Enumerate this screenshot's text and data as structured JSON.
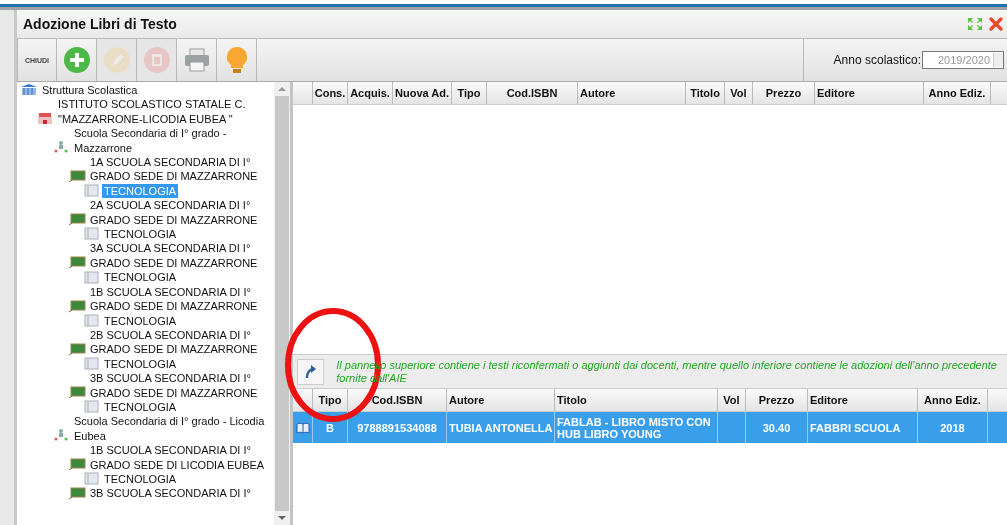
{
  "window": {
    "title": "Adozione Libri di Testo"
  },
  "toolbar": {
    "buttons": [
      {
        "kind": "close",
        "label": "CHIUDI",
        "disabled": false
      },
      {
        "kind": "add",
        "disabled": false
      },
      {
        "kind": "edit",
        "disabled": true
      },
      {
        "kind": "delete",
        "disabled": true
      },
      {
        "kind": "print",
        "disabled": false
      },
      {
        "kind": "hint",
        "disabled": false
      }
    ],
    "school_year": {
      "label": "Anno scolastico:",
      "value": "2019/2020"
    }
  },
  "tree": {
    "kind": "structure",
    "label": "Struttura Scolastica",
    "selected": false,
    "children": [
      {
        "kind": "institute",
        "label": "ISTITUTO SCOLASTICO STATALE C. \"MAZZARRONE-LICODIA EUBEA \"",
        "selected": false,
        "children": [
          {
            "kind": "school",
            "label": "Scuola Secondaria di I° grado - Mazzarrone",
            "selected": false,
            "children": [
              {
                "kind": "class",
                "label": "1A SCUOLA SECONDARIA DI I° GRADO SEDE DI MAZZARRONE",
                "selected": false,
                "children": [
                  {
                    "kind": "subject",
                    "label": "TECNOLOGIA",
                    "selected": true
                  }
                ]
              },
              {
                "kind": "class",
                "label": "2A SCUOLA SECONDARIA DI I° GRADO SEDE DI MAZZARRONE",
                "selected": false,
                "children": [
                  {
                    "kind": "subject",
                    "label": "TECNOLOGIA",
                    "selected": false
                  }
                ]
              },
              {
                "kind": "class",
                "label": "3A SCUOLA SECONDARIA DI I° GRADO SEDE DI MAZZARRONE",
                "selected": false,
                "children": [
                  {
                    "kind": "subject",
                    "label": "TECNOLOGIA",
                    "selected": false
                  }
                ]
              },
              {
                "kind": "class",
                "label": "1B SCUOLA SECONDARIA DI I° GRADO SEDE DI MAZZARRONE",
                "selected": false,
                "children": [
                  {
                    "kind": "subject",
                    "label": "TECNOLOGIA",
                    "selected": false
                  }
                ]
              },
              {
                "kind": "class",
                "label": "2B SCUOLA SECONDARIA DI I° GRADO SEDE DI MAZZARRONE",
                "selected": false,
                "children": [
                  {
                    "kind": "subject",
                    "label": "TECNOLOGIA",
                    "selected": false
                  }
                ]
              },
              {
                "kind": "class",
                "label": "3B SCUOLA SECONDARIA DI I° GRADO SEDE DI MAZZARRONE",
                "selected": false,
                "children": [
                  {
                    "kind": "subject",
                    "label": "TECNOLOGIA",
                    "selected": false
                  }
                ]
              }
            ]
          },
          {
            "kind": "school",
            "label": "Scuola Secondaria di I° grado - Licodia Eubea",
            "selected": false,
            "children": [
              {
                "kind": "class",
                "label": "1B SCUOLA SECONDARIA DI I° GRADO SEDE DI LICODIA EUBEA",
                "selected": false,
                "children": [
                  {
                    "kind": "subject",
                    "label": "TECNOLOGIA",
                    "selected": false
                  }
                ]
              },
              {
                "kind": "class",
                "label": "3B SCUOLA SECONDARIA DI I°",
                "selected": false
              }
            ]
          }
        ]
      }
    ]
  },
  "upper_table": {
    "columns": [
      "Cons.",
      "Acquis.",
      "Nuova Ad.",
      "Tipo",
      "Cod.ISBN",
      "Autore",
      "Titolo",
      "Vol",
      "Prezzo",
      "Editore",
      "Anno Ediz."
    ]
  },
  "info_bar": {
    "message": "Il pannello superiore contiene i testi riconfermati o aggiunti dai docenti, mentre quello inferiore contiene le adozioni dell'anno precedente fornite dall'AIE"
  },
  "lower_table": {
    "columns": [
      "Tipo",
      "Cod.ISBN",
      "Autore",
      "Titolo",
      "Vol",
      "Prezzo",
      "Editore",
      "Anno Ediz."
    ],
    "rows": [
      {
        "selected": true,
        "cells": [
          "B",
          "9788891534088",
          "TUBIA ANTONELLA",
          "FABLAB - LIBRO MISTO CON HUB LIBRO YOUNG",
          "",
          "30.40",
          "FABBRI SCUOLA",
          "2018"
        ]
      }
    ]
  }
}
